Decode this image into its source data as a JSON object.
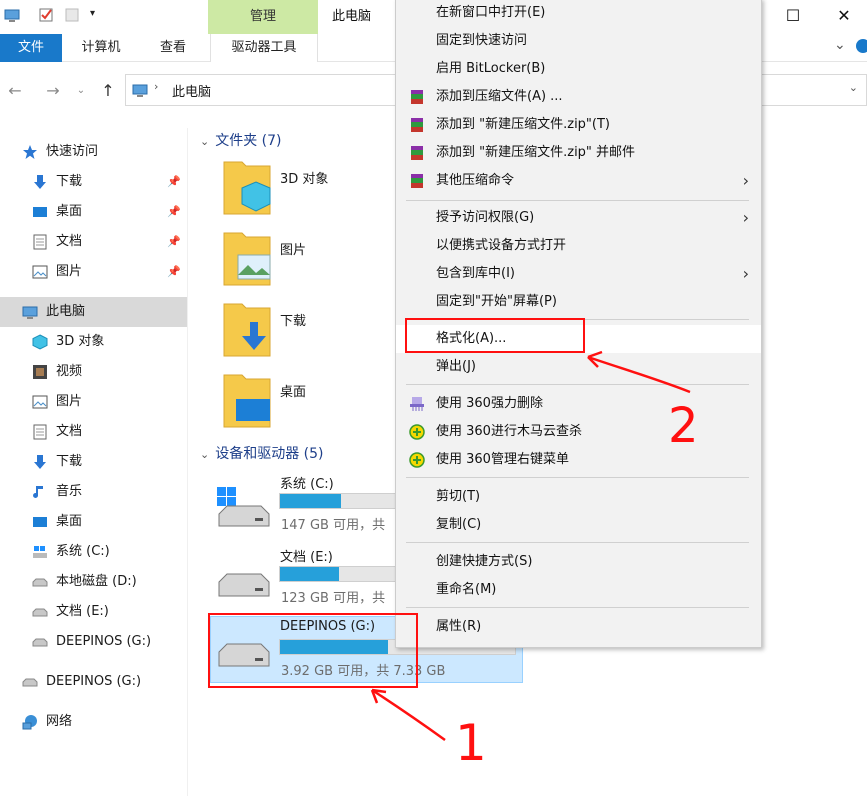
{
  "titlebar": {
    "context_tab": "管理",
    "title": "此电脑"
  },
  "ribbon": {
    "tabs": [
      "文件",
      "计算机",
      "查看",
      "驱动器工具"
    ]
  },
  "address": {
    "path": "此电脑"
  },
  "nav": {
    "quick_access": "快速访问",
    "quick_items": [
      "下载",
      "桌面",
      "文档",
      "图片"
    ],
    "this_pc": "此电脑",
    "pc_items": [
      "3D 对象",
      "视频",
      "图片",
      "文档",
      "下载",
      "音乐",
      "桌面",
      "系统 (C:)",
      "本地磁盘 (D:)",
      "文档 (E:)",
      "DEEPINOS (G:)"
    ],
    "removable": "DEEPINOS (G:)",
    "network": "网络"
  },
  "content": {
    "folders_header": "文件夹 (7)",
    "folders": [
      "3D 对象",
      "图片",
      "下载",
      "桌面"
    ],
    "devices_header": "设备和驱动器 (5)",
    "drives": [
      {
        "name": "系统 (C:)",
        "free_text": "147 GB 可用，共",
        "used_fraction": 0.26
      },
      {
        "name": "文档 (E:)",
        "free_text": "123 GB 可用，共",
        "used_fraction": 0.25
      },
      {
        "name": "DEEPINOS (G:)",
        "free_text": "3.92 GB 可用，共 7.33 GB",
        "used_fraction": 0.46
      }
    ]
  },
  "menu": {
    "items": [
      "在新窗口中打开(E)",
      "固定到快速访问",
      "启用 BitLocker(B)",
      "添加到压缩文件(A) ...",
      "添加到 \"新建压缩文件.zip\"(T)",
      "添加到 \"新建压缩文件.zip\" 并邮件",
      "其他压缩命令",
      "授予访问权限(G)",
      "以便携式设备方式打开",
      "包含到库中(I)",
      "固定到\"开始\"屏幕(P)",
      "格式化(A)...",
      "弹出(J)",
      "使用 360强力删除",
      "使用 360进行木马云查杀",
      "使用 360管理右键菜单",
      "剪切(T)",
      "复制(C)",
      "创建快捷方式(S)",
      "重命名(M)",
      "属性(R)"
    ]
  },
  "annotations": {
    "mark_drive": "1",
    "mark_format": "2",
    "color": "#ff1010"
  }
}
